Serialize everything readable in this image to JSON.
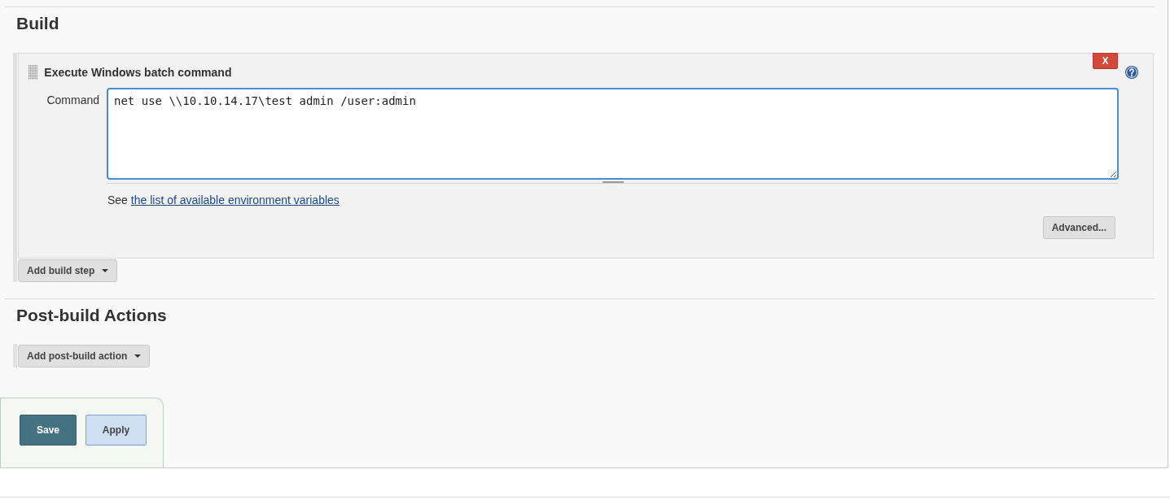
{
  "sections": [
    {
      "title": "Build",
      "steps": [
        {
          "title": "Execute Windows batch command",
          "delete_label": "X",
          "fields": [
            {
              "label": "Command",
              "value": "net use \\\\10.10.14.17\\test admin /user:admin",
              "focused": true
            }
          ],
          "help_prefix": "See",
          "help_link": "the list of available environment variables",
          "advanced_label": "Advanced..."
        }
      ],
      "add_button": "Add build step"
    },
    {
      "title": "Post-build Actions",
      "add_button": "Add post-build action"
    }
  ],
  "buttons": [
    {
      "label": "Save",
      "kind": "primary"
    },
    {
      "label": "Apply",
      "kind": "secondary"
    }
  ]
}
